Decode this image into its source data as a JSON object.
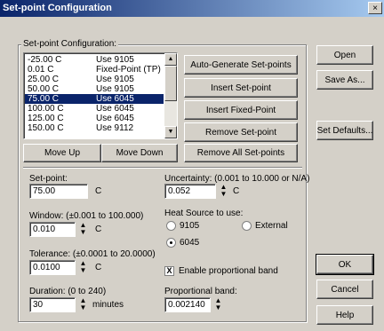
{
  "window": {
    "title": "Set-point Configuration",
    "close_glyph": "×"
  },
  "setpoints_group": {
    "label": "Set-point Configuration:"
  },
  "setpoint_list": [
    {
      "temp": "-25.00 C",
      "source": "Use 9105",
      "selected": false
    },
    {
      "temp": "0.01 C",
      "source": "Fixed-Point (TP)",
      "selected": false
    },
    {
      "temp": "25.00 C",
      "source": "Use 9105",
      "selected": false
    },
    {
      "temp": "50.00 C",
      "source": "Use 9105",
      "selected": false
    },
    {
      "temp": "75.00 C",
      "source": "Use 6045",
      "selected": true
    },
    {
      "temp": "100.00 C",
      "source": "Use 6045",
      "selected": false
    },
    {
      "temp": "125.00 C",
      "source": "Use 6045",
      "selected": false
    },
    {
      "temp": "150.00 C",
      "source": "Use 9112",
      "selected": false
    }
  ],
  "buttons": {
    "move_up": "Move Up",
    "move_down": "Move Down",
    "auto_generate": "Auto-Generate Set-points",
    "insert_setpoint": "Insert Set-point",
    "insert_fixed": "Insert Fixed-Point",
    "remove_setpoint": "Remove Set-point",
    "remove_all": "Remove All Set-points",
    "open": "Open",
    "save_as": "Save As...",
    "set_defaults": "Set Defaults...",
    "ok": "OK",
    "cancel": "Cancel",
    "help": "Help"
  },
  "fields": {
    "setpoint": {
      "label": "Set-point:",
      "value": "75.00",
      "unit": "C"
    },
    "window": {
      "label": "Window: (±0.001 to 100.000)",
      "value": "0.010",
      "unit": "C"
    },
    "tolerance": {
      "label": "Tolerance: (±0.0001 to 20.0000)",
      "value": "0.0100",
      "unit": "C"
    },
    "duration": {
      "label": "Duration: (0 to 240)",
      "value": "30",
      "unit": "minutes"
    },
    "uncertainty": {
      "label": "Uncertainty: (0.001 to 10.000 or N/A)",
      "value": "0.052",
      "unit": "C"
    },
    "proportional_band": {
      "label": "Proportional band:",
      "value": "0.002140"
    }
  },
  "heat_source": {
    "label": "Heat Source to use:",
    "options": [
      "9105",
      "External",
      "6045"
    ],
    "selected": "6045"
  },
  "enable_prop_band": {
    "label": "Enable proportional band",
    "checked": true,
    "mark": "X"
  },
  "glyphs": {
    "up": "▲",
    "down": "▼"
  }
}
